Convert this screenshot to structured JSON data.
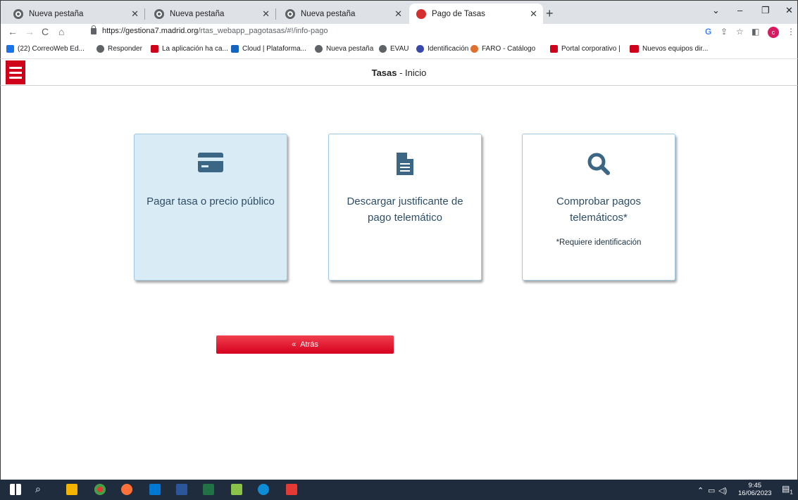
{
  "browser": {
    "tabs": [
      {
        "title": "Nueva pestaña",
        "favicon": "chrome-icon"
      },
      {
        "title": "Nueva pestaña",
        "favicon": "chrome-icon"
      },
      {
        "title": "Nueva pestaña",
        "favicon": "chrome-icon"
      },
      {
        "title": "Pago de Tasas",
        "favicon": "madrid-icon",
        "active": true
      }
    ],
    "url_host": "https://gestiona7.madrid.org",
    "url_path": "/rtas_webapp_pagotasas/#!/info-pago",
    "profile_initial": "c",
    "bookmarks": [
      {
        "label": "(22) CorreoWeb Ed...",
        "icon": "mail-icon",
        "color": "#1a73e8"
      },
      {
        "label": "Responder",
        "icon": "chrome-icon",
        "color": "#5f6368"
      },
      {
        "label": "La aplicación ha ca...",
        "icon": "madrid-icon",
        "color": "#d0021b"
      },
      {
        "label": "Cloud | Plataforma...",
        "icon": "help-icon",
        "color": "#1565c0"
      },
      {
        "label": "Nueva pestaña",
        "icon": "chrome-icon",
        "color": "#5f6368"
      },
      {
        "label": "EVAU",
        "icon": "chrome-icon",
        "color": "#5f6368"
      },
      {
        "label": "Identificación",
        "icon": "fingerprint-icon",
        "color": "#3949ab"
      },
      {
        "label": "FARO - Catálogo",
        "icon": "faro-icon",
        "color": "#e07030"
      },
      {
        "label": "Portal corporativo |",
        "icon": "madrid-icon",
        "color": "#d0021b"
      },
      {
        "label": "Nuevos equipos dir...",
        "icon": "dat-icon",
        "color": "#d0021b"
      }
    ]
  },
  "app": {
    "title_bold": "Tasas",
    "title_rest": " - Inicio"
  },
  "cards": [
    {
      "title": "Pagar tasa o precio público",
      "icon": "credit-card-icon",
      "selected": true
    },
    {
      "title": "Descargar justificante de pago telemático",
      "icon": "document-icon"
    },
    {
      "title": "Comprobar pagos telemáticos*",
      "icon": "search-icon",
      "note": "*Requiere identificación"
    }
  ],
  "back_label": "Atrás",
  "taskbar": {
    "time": "9:45",
    "date": "16/06/2023",
    "notification_count": "1"
  },
  "colors": {
    "accent_red": "#d0021b",
    "card_text": "#2e4e66",
    "card_border": "#9ec9e3"
  }
}
